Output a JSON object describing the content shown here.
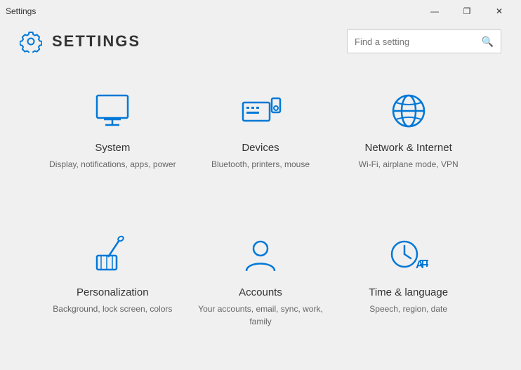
{
  "window": {
    "title": "Settings",
    "controls": {
      "minimize": "—",
      "maximize": "❐",
      "close": "✕"
    }
  },
  "header": {
    "icon_label": "settings-gear-icon",
    "title": "SETTINGS",
    "search_placeholder": "Find a setting"
  },
  "tiles": [
    {
      "id": "system",
      "title": "System",
      "desc": "Display, notifications, apps, power",
      "icon": "system"
    },
    {
      "id": "devices",
      "title": "Devices",
      "desc": "Bluetooth, printers, mouse",
      "icon": "devices"
    },
    {
      "id": "network",
      "title": "Network & Internet",
      "desc": "Wi-Fi, airplane mode, VPN",
      "icon": "network"
    },
    {
      "id": "personalization",
      "title": "Personalization",
      "desc": "Background, lock screen, colors",
      "icon": "personalization"
    },
    {
      "id": "accounts",
      "title": "Accounts",
      "desc": "Your accounts, email, sync, work, family",
      "icon": "accounts"
    },
    {
      "id": "time",
      "title": "Time & language",
      "desc": "Speech, region, date",
      "icon": "time"
    }
  ],
  "accent_color": "#0078d7"
}
